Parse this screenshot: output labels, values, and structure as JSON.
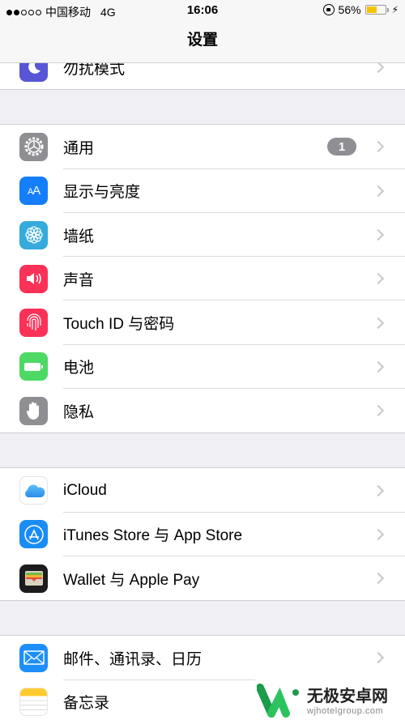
{
  "status_bar": {
    "signal_bars_filled": 2,
    "signal_bars_total": 5,
    "carrier": "中国移动",
    "network": "4G",
    "time": "16:06",
    "battery_percent_text": "56%",
    "battery_level": 0.56,
    "battery_color": "#f5c400",
    "icons": [
      "orientation-lock-icon",
      "battery-icon",
      "charging-bolt-icon"
    ]
  },
  "nav": {
    "title": "设置"
  },
  "groups": [
    {
      "items": [
        {
          "label": "勿扰模式",
          "icon": "moon-icon",
          "color": "#5856d6"
        }
      ]
    },
    {
      "items": [
        {
          "label": "通用",
          "icon": "gear-icon",
          "color": "#8e8e93",
          "badge": "1"
        },
        {
          "label": "显示与亮度",
          "icon": "text-size-icon",
          "color": "#147efb",
          "glyph": "AA"
        },
        {
          "label": "墙纸",
          "icon": "flower-icon",
          "color": "#35aadc"
        },
        {
          "label": "声音",
          "icon": "speaker-icon",
          "color": "#fc3158"
        },
        {
          "label": "Touch ID 与密码",
          "icon": "fingerprint-icon",
          "color": "#fc3158"
        },
        {
          "label": "电池",
          "icon": "battery-icon",
          "color": "#4cd964"
        },
        {
          "label": "隐私",
          "icon": "hand-icon",
          "color": "#8e8e93"
        }
      ]
    },
    {
      "items": [
        {
          "label": "iCloud",
          "icon": "cloud-icon",
          "color": "#ffffff"
        },
        {
          "label": "iTunes Store 与 App Store",
          "icon": "app-store-icon",
          "color": "#1a8cf5"
        },
        {
          "label": "Wallet 与 Apple Pay",
          "icon": "wallet-icon",
          "color": "#1c1c1e"
        }
      ]
    },
    {
      "items": [
        {
          "label": "邮件、通讯录、日历",
          "icon": "mail-icon",
          "color": "#1d8ffc"
        },
        {
          "label": "备忘录",
          "icon": "notes-icon",
          "color": "#ffffff"
        }
      ]
    }
  ],
  "watermark": {
    "title": "无极安卓网",
    "url": "wjhotelgroup.com"
  }
}
